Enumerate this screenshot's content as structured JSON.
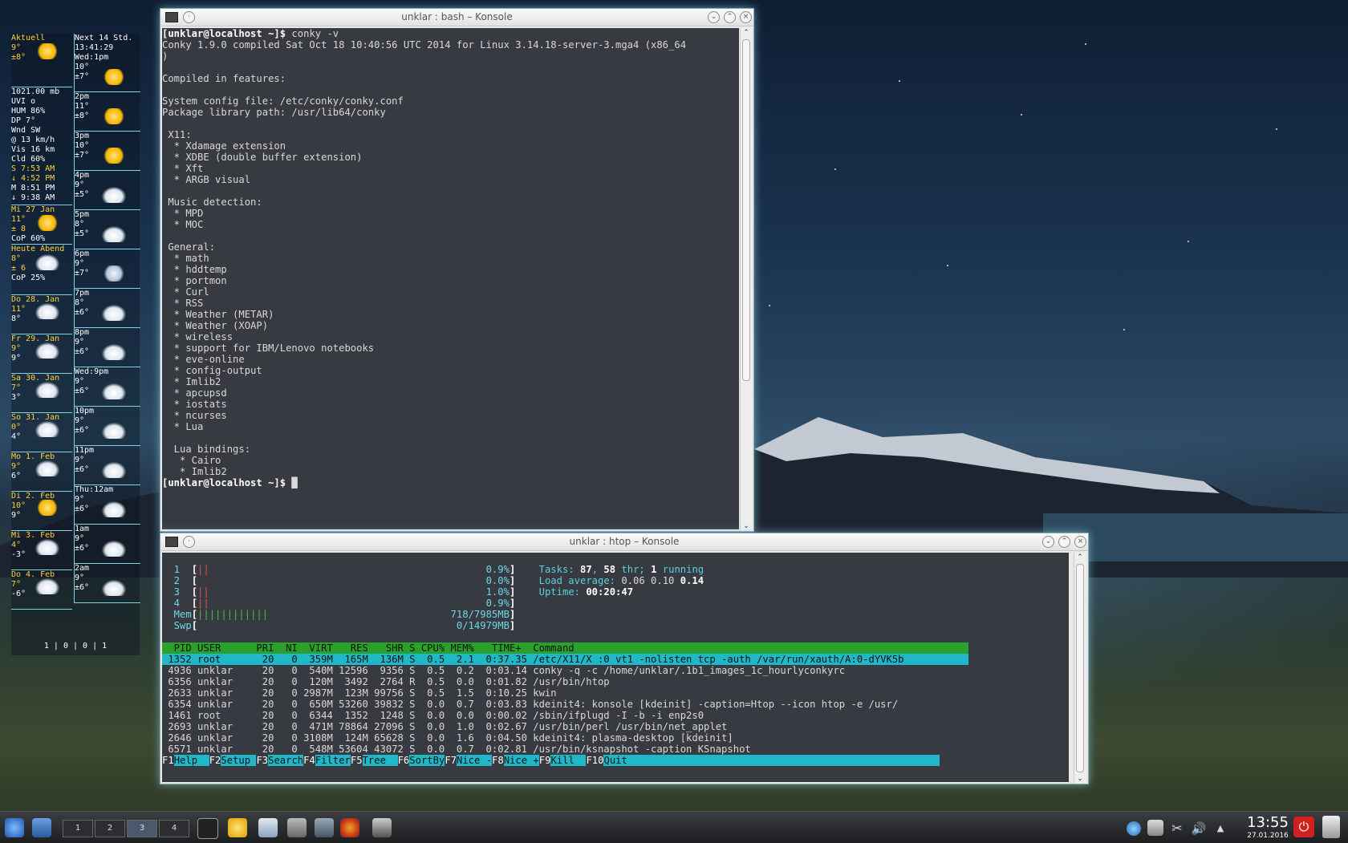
{
  "conky": {
    "left": [
      {
        "lines": [
          {
            "t": "Aktuell",
            "c": "yel"
          },
          {
            "t": "9°",
            "c": "yel"
          },
          {
            "t": ""
          },
          {
            "t": "        ±8°",
            "c": "yel"
          }
        ],
        "icon": "sun",
        "h": 66
      },
      {
        "lines": [
          {
            "t": "1021.00 mb"
          },
          {
            "t": "UVI o"
          },
          {
            "t": "HUM 86%"
          },
          {
            "t": "DP  7°"
          },
          {
            "t": "Wnd SW"
          },
          {
            "t": "@ 13 km/h"
          },
          {
            "t": "Vis 16 km"
          },
          {
            "t": "Cld 60%"
          },
          {
            "t": "S 7:53 AM",
            "c": "yel"
          },
          {
            "t": "↓ 4:52 PM",
            "c": "yel"
          },
          {
            "t": "M 8:51 PM"
          },
          {
            "t": "↓ 9:38 AM"
          }
        ],
        "h": 146
      },
      {
        "lines": [
          {
            "t": "Mi 27 Jan",
            "c": "yel"
          },
          {
            "t": "11°",
            "c": "yel"
          },
          {
            "t": "± 8",
            "c": "yel"
          },
          {
            "t": "CoP  60%"
          }
        ],
        "icon": "sun",
        "h": 48
      },
      {
        "lines": [
          {
            "t": "Heute Abend",
            "c": "yel"
          },
          {
            "t": "8°",
            "c": "yel"
          },
          {
            "t": "± 6",
            "c": "yel"
          },
          {
            "t": "CoP  25%"
          }
        ],
        "icon": "cloud",
        "h": 62
      },
      {
        "lines": [
          {
            "t": "Do 28. Jan",
            "c": "yel"
          },
          {
            "t": "11°",
            "c": "yel"
          },
          {
            "t": "8°"
          }
        ],
        "icon": "cloud",
        "h": 48
      },
      {
        "lines": [
          {
            "t": "Fr 29. Jan",
            "c": "yel"
          },
          {
            "t": "9°",
            "c": "yel"
          },
          {
            "t": "9°"
          }
        ],
        "icon": "cloud",
        "h": 48
      },
      {
        "lines": [
          {
            "t": "Sa 30. Jan",
            "c": "yel"
          },
          {
            "t": "7°",
            "c": "yel"
          },
          {
            "t": "3°"
          }
        ],
        "icon": "cloud",
        "h": 48
      },
      {
        "lines": [
          {
            "t": "So 31. Jan",
            "c": "yel"
          },
          {
            "t": "0°",
            "c": "yel"
          },
          {
            "t": "4°"
          }
        ],
        "icon": "cloud",
        "h": 48
      },
      {
        "lines": [
          {
            "t": "Mo 1. Feb",
            "c": "yel"
          },
          {
            "t": "9°",
            "c": "yel"
          },
          {
            "t": "6°"
          }
        ],
        "icon": "cloud",
        "h": 48
      },
      {
        "lines": [
          {
            "t": "Di 2. Feb",
            "c": "yel"
          },
          {
            "t": "10°",
            "c": "yel"
          },
          {
            "t": "9°"
          }
        ],
        "icon": "sun",
        "h": 48
      },
      {
        "lines": [
          {
            "t": "Mi 3. Feb",
            "c": "yel"
          },
          {
            "t": "4°",
            "c": "yel"
          },
          {
            "t": "-3°"
          }
        ],
        "icon": "cloud",
        "h": 48
      },
      {
        "lines": [
          {
            "t": "Do 4. Feb",
            "c": "yel"
          },
          {
            "t": "7°",
            "c": "yel"
          },
          {
            "t": "-6°"
          }
        ],
        "icon": "cloud",
        "h": 48
      }
    ],
    "right": [
      {
        "lines": [
          {
            "t": "Next 14 Std."
          },
          {
            "t": "  13:41:29"
          },
          {
            "t": "Wed:1pm"
          },
          {
            "t": "10°"
          },
          {
            "t": "±7°"
          }
        ],
        "icon": "sun",
        "h": 72
      },
      {
        "lines": [
          {
            "t": "2pm"
          },
          {
            "t": "11°"
          },
          {
            "t": "±8°"
          }
        ],
        "icon": "sun",
        "h": 48
      },
      {
        "lines": [
          {
            "t": "3pm"
          },
          {
            "t": "10°"
          },
          {
            "t": "±7°"
          }
        ],
        "icon": "sun",
        "h": 48
      },
      {
        "lines": [
          {
            "t": "4pm"
          },
          {
            "t": "9°"
          },
          {
            "t": "±5°"
          }
        ],
        "icon": "cloud",
        "h": 48
      },
      {
        "lines": [
          {
            "t": "5pm"
          },
          {
            "t": "8°"
          },
          {
            "t": "±5°"
          }
        ],
        "icon": "cloud",
        "h": 48
      },
      {
        "lines": [
          {
            "t": "6pm"
          },
          {
            "t": "9°"
          },
          {
            "t": "±7°"
          }
        ],
        "icon": "moon",
        "h": 48
      },
      {
        "lines": [
          {
            "t": "7pm"
          },
          {
            "t": "8°"
          },
          {
            "t": "±6°"
          }
        ],
        "icon": "cloud",
        "h": 48
      },
      {
        "lines": [
          {
            "t": "8pm"
          },
          {
            "t": "9°"
          },
          {
            "t": "±6°"
          }
        ],
        "icon": "cloud",
        "h": 48
      },
      {
        "lines": [
          {
            "t": "Wed:9pm"
          },
          {
            "t": "9°"
          },
          {
            "t": "±6°"
          }
        ],
        "icon": "cloud",
        "h": 48
      },
      {
        "lines": [
          {
            "t": "10pm"
          },
          {
            "t": "9°"
          },
          {
            "t": "±6°"
          }
        ],
        "icon": "cloud",
        "h": 48
      },
      {
        "lines": [
          {
            "t": "11pm"
          },
          {
            "t": "9°"
          },
          {
            "t": "±6°"
          }
        ],
        "icon": "cloud",
        "h": 48
      },
      {
        "lines": [
          {
            "t": "Thu:12am"
          },
          {
            "t": "9°"
          },
          {
            "t": "±6°"
          }
        ],
        "icon": "cloud",
        "h": 48
      },
      {
        "lines": [
          {
            "t": "1am"
          },
          {
            "t": "9°"
          },
          {
            "t": "±6°"
          }
        ],
        "icon": "cloud",
        "h": 48
      },
      {
        "lines": [
          {
            "t": "2am"
          },
          {
            "t": "9°"
          },
          {
            "t": "±6°"
          }
        ],
        "icon": "cloud",
        "h": 48
      }
    ],
    "footer": "1 | 0 | 0 | 1"
  },
  "konsole1": {
    "title": "unklar : bash – Konsole",
    "lines": [
      [
        {
          "t": "[unklar@localhost ~]$",
          "c": "prompt"
        },
        {
          "t": " conky -v"
        }
      ],
      [
        {
          "t": "Conky 1.9.0 compiled Sat Oct 18 10:40:56 UTC 2014 for Linux 3.14.18-server-3.mga4 (x86_64"
        }
      ],
      [
        {
          "t": ")"
        }
      ],
      [
        {
          "t": ""
        }
      ],
      [
        {
          "t": "Compiled in features:"
        }
      ],
      [
        {
          "t": ""
        }
      ],
      [
        {
          "t": "System config file: /etc/conky/conky.conf"
        }
      ],
      [
        {
          "t": "Package library path: /usr/lib64/conky"
        }
      ],
      [
        {
          "t": ""
        }
      ],
      [
        {
          "t": " X11:"
        }
      ],
      [
        {
          "t": "  * Xdamage extension"
        }
      ],
      [
        {
          "t": "  * XDBE (double buffer extension)"
        }
      ],
      [
        {
          "t": "  * Xft"
        }
      ],
      [
        {
          "t": "  * ARGB visual"
        }
      ],
      [
        {
          "t": ""
        }
      ],
      [
        {
          "t": " Music detection:"
        }
      ],
      [
        {
          "t": "  * MPD"
        }
      ],
      [
        {
          "t": "  * MOC"
        }
      ],
      [
        {
          "t": ""
        }
      ],
      [
        {
          "t": " General:"
        }
      ],
      [
        {
          "t": "  * math"
        }
      ],
      [
        {
          "t": "  * hddtemp"
        }
      ],
      [
        {
          "t": "  * portmon"
        }
      ],
      [
        {
          "t": "  * Curl"
        }
      ],
      [
        {
          "t": "  * RSS"
        }
      ],
      [
        {
          "t": "  * Weather (METAR)"
        }
      ],
      [
        {
          "t": "  * Weather (XOAP)"
        }
      ],
      [
        {
          "t": "  * wireless"
        }
      ],
      [
        {
          "t": "  * support for IBM/Lenovo notebooks"
        }
      ],
      [
        {
          "t": "  * eve-online"
        }
      ],
      [
        {
          "t": "  * config-output"
        }
      ],
      [
        {
          "t": "  * Imlib2"
        }
      ],
      [
        {
          "t": "  * apcupsd"
        }
      ],
      [
        {
          "t": "  * iostats"
        }
      ],
      [
        {
          "t": "  * ncurses"
        }
      ],
      [
        {
          "t": "  * Lua"
        }
      ],
      [
        {
          "t": ""
        }
      ],
      [
        {
          "t": "  Lua bindings:"
        }
      ],
      [
        {
          "t": "   * Cairo"
        }
      ],
      [
        {
          "t": "   * Imlib2"
        }
      ],
      [
        {
          "t": "[unklar@localhost ~]$",
          "c": "prompt"
        },
        {
          "t": " █"
        }
      ]
    ]
  },
  "konsole2": {
    "title": "unklar : htop – Konsole",
    "lines": [
      [
        {
          "t": ""
        }
      ],
      [
        {
          "t": "  1  ",
          "c": "hb"
        },
        {
          "t": "[",
          "c": "bold"
        },
        {
          "t": "||",
          "c": "red"
        },
        {
          "t": "                                               0.9%",
          "c": "hb"
        },
        {
          "t": "]",
          "c": "bold"
        },
        {
          "t": "    Tasks: ",
          "c": "cyan"
        },
        {
          "t": "87",
          "c": "bold"
        },
        {
          "t": ", ",
          "c": "cyan"
        },
        {
          "t": "58",
          "c": "bold"
        },
        {
          "t": " thr; ",
          "c": "cyan"
        },
        {
          "t": "1",
          "c": "bold"
        },
        {
          "t": " running",
          "c": "cyan"
        }
      ],
      [
        {
          "t": "  2  ",
          "c": "hb"
        },
        {
          "t": "[",
          "c": "bold"
        },
        {
          "t": "                                                 0.0%",
          "c": "hb"
        },
        {
          "t": "]",
          "c": "bold"
        },
        {
          "t": "    Load average: ",
          "c": "cyan"
        },
        {
          "t": "0.06 0.10 "
        },
        {
          "t": "0.14",
          "c": "bold"
        }
      ],
      [
        {
          "t": "  3  ",
          "c": "hb"
        },
        {
          "t": "[",
          "c": "bold"
        },
        {
          "t": "||",
          "c": "red"
        },
        {
          "t": "                                               1.0%",
          "c": "hb"
        },
        {
          "t": "]",
          "c": "bold"
        },
        {
          "t": "    Uptime: ",
          "c": "cyan"
        },
        {
          "t": "00:20:47",
          "c": "bold"
        }
      ],
      [
        {
          "t": "  4  ",
          "c": "hb"
        },
        {
          "t": "[",
          "c": "bold"
        },
        {
          "t": "||",
          "c": "red"
        },
        {
          "t": "                                               0.9%",
          "c": "hb"
        },
        {
          "t": "]",
          "c": "bold"
        }
      ],
      [
        {
          "t": "  Mem",
          "c": "hb"
        },
        {
          "t": "[",
          "c": "bold"
        },
        {
          "t": "||||||||||||",
          "c": "green"
        },
        {
          "t": "                               718/7985MB",
          "c": "hb"
        },
        {
          "t": "]",
          "c": "bold"
        }
      ],
      [
        {
          "t": "  Swp",
          "c": "hb"
        },
        {
          "t": "[",
          "c": "bold"
        },
        {
          "t": "                                            0/14979MB",
          "c": "hb"
        },
        {
          "t": "]",
          "c": "bold"
        }
      ],
      [
        {
          "t": ""
        }
      ],
      [
        {
          "t": "  PID USER      PRI  NI  VIRT   RES   SHR S CPU% MEM%   TIME+  Command                                                                   ",
          "c": "hdr"
        }
      ],
      [
        {
          "t": " 1352 root       20   0  359M  165M  136M S  0.5  2.1  0:37.35 /etc/X11/X :0 vt1 -nolisten tcp -auth /var/run/xauth/A:0-dYVK5b           ",
          "c": "sel"
        }
      ],
      [
        {
          "t": " 4936 unklar     20   0  540M 12596  9356 S  0.5  0.2  0:03.14 conky -q -c /home/unklar/.1b1_images_1c_hourlyconkyrc"
        }
      ],
      [
        {
          "t": " 6356 unklar     20   0  120M  3492  2764 R  0.5  0.0  0:01.82 /usr/bin/htop"
        }
      ],
      [
        {
          "t": " 2633 unklar     20   0 2987M  123M 99756 S  0.5  1.5  0:10.25 kwin"
        }
      ],
      [
        {
          "t": " 6354 unklar     20   0  650M 53260 39832 S  0.0  0.7  0:03.83 kdeinit4: konsole [kdeinit] -caption=Htop --icon htop -e /usr/"
        }
      ],
      [
        {
          "t": " 1461 root       20   0  6344  1352  1248 S  0.0  0.0  0:00.02 /sbin/ifplugd -I -b -i enp2s0"
        }
      ],
      [
        {
          "t": " 2693 unklar     20   0  471M 78864 27096 S  0.0  1.0  0:02.67 /usr/bin/perl /usr/bin/net_applet"
        }
      ],
      [
        {
          "t": " 2646 unklar     20   0 3108M  124M 65628 S  0.0  1.6  0:04.50 kdeinit4: plasma-desktop [kdeinit]"
        }
      ],
      [
        {
          "t": " 6571 unklar     20   0  548M 53604 43072 S  0.0  0.7  0:02.81 /usr/bin/ksnapshot -caption KSnapshot"
        }
      ],
      [
        {
          "t": "F1",
          "c": "fk"
        },
        {
          "t": "Help  ",
          "c": "fl"
        },
        {
          "t": "F2",
          "c": "fk"
        },
        {
          "t": "Setup ",
          "c": "fl"
        },
        {
          "t": "F3",
          "c": "fk"
        },
        {
          "t": "Search",
          "c": "fl"
        },
        {
          "t": "F4",
          "c": "fk"
        },
        {
          "t": "Filter",
          "c": "fl"
        },
        {
          "t": "F5",
          "c": "fk"
        },
        {
          "t": "Tree  ",
          "c": "fl"
        },
        {
          "t": "F6",
          "c": "fk"
        },
        {
          "t": "SortBy",
          "c": "fl"
        },
        {
          "t": "F7",
          "c": "fk"
        },
        {
          "t": "Nice -",
          "c": "fl"
        },
        {
          "t": "F8",
          "c": "fk"
        },
        {
          "t": "Nice +",
          "c": "fl"
        },
        {
          "t": "F9",
          "c": "fk"
        },
        {
          "t": "Kill  ",
          "c": "fl"
        },
        {
          "t": "F10",
          "c": "fk"
        },
        {
          "t": "Quit                                                     ",
          "c": "fl"
        }
      ]
    ]
  },
  "panel": {
    "pager": [
      "1",
      "2",
      "3",
      "4"
    ],
    "clock_time": "13:55",
    "clock_date": "27.01.2016",
    "launchers": [
      "konsole-icon",
      "smiley-icon",
      "notes-icon",
      "tools-icon",
      "settings-icon",
      "firefox-icon",
      "ksnapshot-icon"
    ],
    "tray": [
      "network-icon",
      "wifi-icon",
      "klipper-icon",
      "volume-icon",
      "expand-arrow-icon"
    ]
  }
}
